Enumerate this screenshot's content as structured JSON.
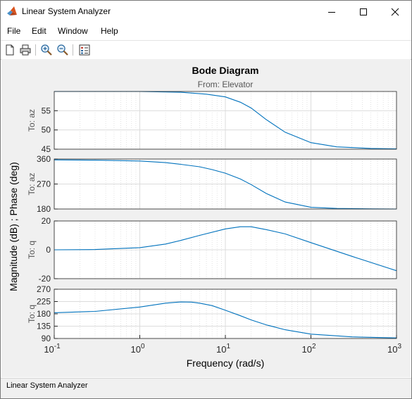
{
  "window": {
    "title": "Linear System Analyzer",
    "controls": [
      "minimize",
      "maximize",
      "close"
    ]
  },
  "menu": [
    "File",
    "Edit",
    "Window",
    "Help"
  ],
  "toolbar": [
    "new-figure-icon",
    "print-icon",
    "zoom-in-icon",
    "zoom-out-icon",
    "legend-icon"
  ],
  "plot": {
    "title": "Bode Diagram",
    "subtitle": "From: Elevator",
    "ylabel": "Magnitude (dB) ; Phase (deg)",
    "xlabel": "Frequency  (rad/s)"
  },
  "status": {
    "text": "Linear System Analyzer"
  },
  "colors": {
    "line": "#0072bd",
    "figure_bg": "#f0f0f0",
    "axes_bg": "#ffffff",
    "grid": "#dcdcdc",
    "tick_text": "#262626",
    "subtitle": "#555555"
  },
  "chart_data": {
    "type": "line",
    "xscale": "log",
    "xlim": [
      0.1,
      1000
    ],
    "x_ticklabels": [
      {
        "base": "10",
        "exp": "-1"
      },
      {
        "base": "10",
        "exp": "0"
      },
      {
        "base": "10",
        "exp": "1"
      },
      {
        "base": "10",
        "exp": "2"
      },
      {
        "base": "10",
        "exp": "3"
      }
    ],
    "grid": true,
    "panels": [
      {
        "label": "To: az",
        "quantity": "magnitude",
        "ylim": [
          45,
          60
        ],
        "yticks": [
          45,
          50,
          55
        ],
        "x": [
          0.1,
          1,
          3,
          6,
          10,
          15,
          20,
          30,
          50,
          100,
          200,
          500,
          1000
        ],
        "y": [
          60,
          60,
          59.8,
          59.3,
          58.6,
          57.2,
          55.7,
          52.7,
          49.4,
          46.7,
          45.6,
          45.2,
          45.1
        ]
      },
      {
        "label": "To: az",
        "quantity": "phase",
        "ylim": [
          180,
          360
        ],
        "yticks": [
          180,
          270,
          360
        ],
        "x": [
          0.1,
          0.3,
          1,
          2,
          3,
          5,
          7,
          10,
          15,
          20,
          30,
          50,
          100,
          200,
          500,
          1000
        ],
        "y": [
          357,
          356,
          353,
          347,
          341,
          332,
          322,
          309,
          288,
          268,
          236,
          205,
          186,
          182,
          180.5,
          180
        ]
      },
      {
        "label": "To: q",
        "quantity": "magnitude",
        "ylim": [
          -20,
          20
        ],
        "yticks": [
          -20,
          0,
          20
        ],
        "x": [
          0.1,
          0.3,
          1,
          2,
          3,
          5,
          10,
          15,
          20,
          30,
          50,
          100,
          300,
          1000
        ],
        "y": [
          0,
          0.2,
          1.5,
          4,
          6.5,
          10,
          14.5,
          16,
          16,
          14,
          11,
          5,
          -4.5,
          -14.5
        ]
      },
      {
        "label": "To: q",
        "quantity": "phase",
        "ylim": [
          90,
          270
        ],
        "yticks": [
          90,
          135,
          180,
          225,
          270
        ],
        "x": [
          0.1,
          0.3,
          1,
          2,
          3,
          4,
          5,
          7,
          10,
          15,
          20,
          30,
          50,
          100,
          300,
          1000
        ],
        "y": [
          184,
          189,
          205,
          219,
          223.5,
          223,
          219,
          210,
          193,
          173,
          158,
          140,
          122,
          106,
          96,
          92
        ]
      }
    ]
  }
}
